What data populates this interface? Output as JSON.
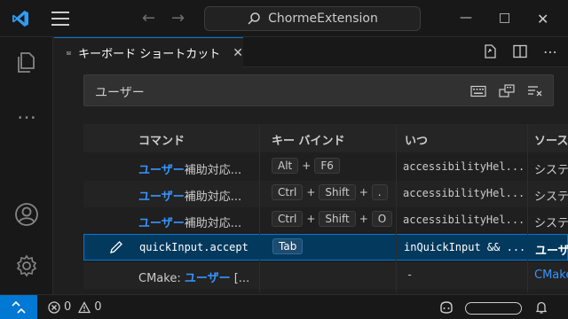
{
  "titlebar": {
    "search_text": "ChormeExtension",
    "icons": [
      "vscode-logo-icon",
      "hamburger-menu-icon",
      "back-arrow-icon",
      "forward-arrow-icon",
      "search-icon",
      "minimize-icon",
      "maximize-icon",
      "close-icon"
    ]
  },
  "activity_bar": {
    "icons": [
      "explorer-icon",
      "more-icon",
      "account-icon",
      "settings-gear-icon"
    ]
  },
  "tab": {
    "label": "キーボード ショートカット",
    "icon": "keyboard-icon"
  },
  "tab_actions": [
    "open-json-icon",
    "split-editor-icon",
    "more-actions-icon"
  ],
  "search": {
    "value": "ユーザー",
    "tools": [
      "record-keys-icon",
      "sort-precedence-icon",
      "clear-filter-icon"
    ]
  },
  "table": {
    "headers": [
      "コマンド",
      "キー バインド",
      "いつ",
      "ソース"
    ],
    "rows": [
      {
        "cmd_prefix": "ユーザー",
        "cmd_rest": "補助対応...",
        "keys": [
          "Alt",
          "F6"
        ],
        "when": "accessibilityHel...",
        "source": "システム"
      },
      {
        "cmd_prefix": "ユーザー",
        "cmd_rest": "補助対応...",
        "keys": [
          "Ctrl",
          "Shift",
          "."
        ],
        "when": "accessibilityHel...",
        "source": "システム"
      },
      {
        "cmd_prefix": "ユーザー",
        "cmd_rest": "補助対応...",
        "keys": [
          "Ctrl",
          "Shift",
          "O"
        ],
        "when": "accessibilityHel...",
        "source": "システム"
      },
      {
        "cmd_prefix": "",
        "cmd_rest": "quickInput.accept",
        "keys": [
          "Tab"
        ],
        "when": "inQuickInput && ...",
        "source": "ユーザー"
      },
      {
        "cmd_prefix": "CMake: ",
        "cmd_rest": "ユーザー",
        "cmd_tail": " [...",
        "keys": [],
        "when": "-",
        "source": "CMake"
      }
    ]
  },
  "statusbar": {
    "errors": "0",
    "warnings": "0"
  },
  "colors": {
    "accent": "#0078d4",
    "highlight_text": "#3794ff",
    "selected_row": "#04395e"
  }
}
